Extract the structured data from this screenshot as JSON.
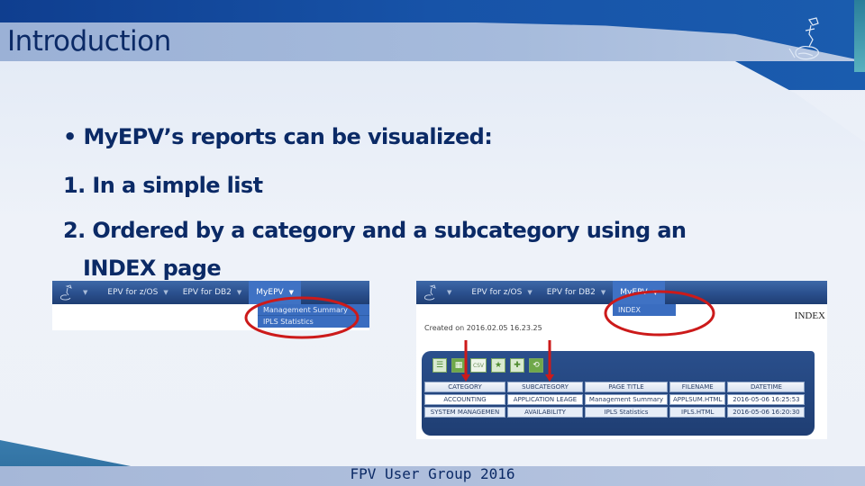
{
  "slide": {
    "title": "Introduction",
    "bullets": [
      "• MyEPV’s reports can be visualized:",
      "1. In a simple list",
      "2. Ordered by a category and a subcategory using an",
      "INDEX page"
    ],
    "footer": "FPV User Group 2016"
  },
  "screenshot_left": {
    "nav": [
      {
        "label": "EPV for z/OS"
      },
      {
        "label": "EPV for DB2"
      },
      {
        "label": "MyEPV"
      }
    ],
    "dropdown": [
      "Management Summary",
      "IPLS Statistics"
    ]
  },
  "screenshot_right": {
    "nav": [
      {
        "label": "EPV for z/OS"
      },
      {
        "label": "EPV for DB2"
      },
      {
        "label": "MyEPV"
      }
    ],
    "dropdown": [
      "INDEX"
    ],
    "page_label": "INDEX",
    "created": "Created on 2016.02.05 16.23.25",
    "toolbar": [
      {
        "icon": "list-icon",
        "glyph": "☰"
      },
      {
        "icon": "excel-icon",
        "glyph": "▦"
      },
      {
        "icon": "csv-icon",
        "glyph": "CSV"
      },
      {
        "icon": "star-icon",
        "glyph": "★"
      },
      {
        "icon": "add-page-icon",
        "glyph": "✚"
      },
      {
        "icon": "refresh-icon",
        "glyph": "⟲"
      }
    ],
    "table": {
      "headers": [
        "CATEGORY",
        "SUBCATEGORY",
        "PAGE TITLE",
        "FILENAME",
        "DATETIME"
      ],
      "rows": [
        [
          "ACCOUNTING",
          "APPLICATION LEAGE",
          "Management Summary",
          "APPLSUM.HTML",
          "2016-05-06 16:25:53"
        ],
        [
          "SYSTEM MANAGEMEN",
          "AVAILABILITY",
          "IPLS Statistics",
          "IPLS.HTML",
          "2016-05-06 16:20:30"
        ]
      ]
    }
  },
  "annotation_color": "#cc1a1a"
}
